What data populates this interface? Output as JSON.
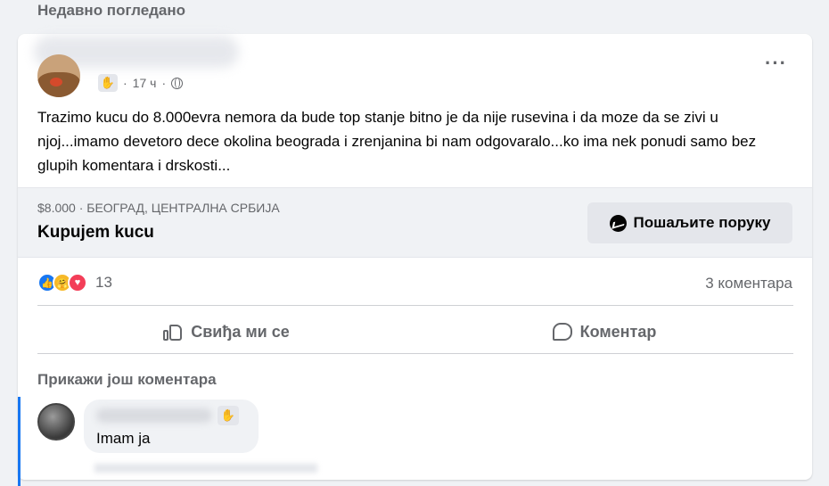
{
  "section_header": "Недавно погледано",
  "post": {
    "time": "17 ч",
    "text": "Trazimo kucu do 8.000evra nemora da bude top stanje bitno je da nije rusevina i da moze da se zivi u njoj...imamo devetoro dece okolina beograda i zrenjanina bi nam odgovaralo...ko ima nek ponudi samo bez glupih komentara i drskosti...",
    "more_icon": "more-horizontal-icon"
  },
  "listing": {
    "meta": "$8.000 · БЕОГРАД, ЦЕНТРАЛНА СРБИЈА",
    "title": "Kupujem kucu",
    "message_button": "Пошаљите поруку"
  },
  "reactions": {
    "count": "13",
    "comments": "3 коментара"
  },
  "actions": {
    "like": "Свиђа ми се",
    "comment": "Коментар"
  },
  "comments": {
    "show_more": "Прикажи још коментара",
    "first_comment_text": "Imam ja"
  },
  "colors": {
    "accent": "#1877f2",
    "background": "#f0f2f5",
    "secondary_text": "#65676b"
  }
}
